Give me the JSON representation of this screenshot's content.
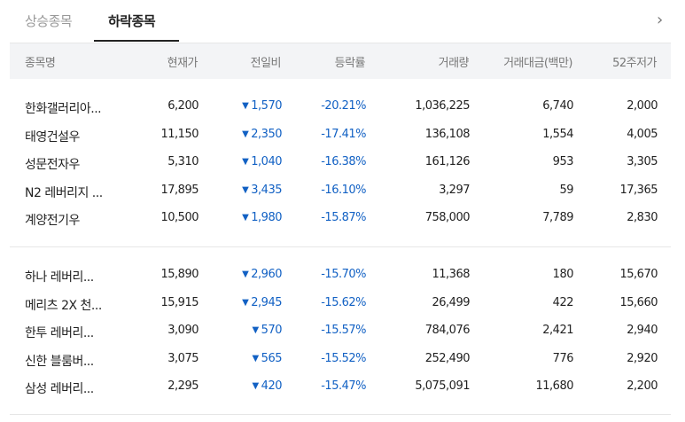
{
  "tabs": [
    {
      "label": "상승종목",
      "active": false
    },
    {
      "label": "하락종목",
      "active": true
    }
  ],
  "columns": [
    "종목명",
    "현재가",
    "전일비",
    "등락률",
    "거래량",
    "거래대금(백만)",
    "52주저가"
  ],
  "groups": [
    [
      {
        "name": "한화갤러리아...",
        "price": "6,200",
        "change": "1,570",
        "rate": "-20.21%",
        "volume": "1,036,225",
        "amount": "6,740",
        "low52": "2,000"
      },
      {
        "name": "태영건설우",
        "price": "11,150",
        "change": "2,350",
        "rate": "-17.41%",
        "volume": "136,108",
        "amount": "1,554",
        "low52": "4,005"
      },
      {
        "name": "성문전자우",
        "price": "5,310",
        "change": "1,040",
        "rate": "-16.38%",
        "volume": "161,126",
        "amount": "953",
        "low52": "3,305"
      },
      {
        "name": "N2 레버리지 ...",
        "price": "17,895",
        "change": "3,435",
        "rate": "-16.10%",
        "volume": "3,297",
        "amount": "59",
        "low52": "17,365"
      },
      {
        "name": "계양전기우",
        "price": "10,500",
        "change": "1,980",
        "rate": "-15.87%",
        "volume": "758,000",
        "amount": "7,789",
        "low52": "2,830"
      }
    ],
    [
      {
        "name": "하나 레버리...",
        "price": "15,890",
        "change": "2,960",
        "rate": "-15.70%",
        "volume": "11,368",
        "amount": "180",
        "low52": "15,670"
      },
      {
        "name": "메리츠 2X 천...",
        "price": "15,915",
        "change": "2,945",
        "rate": "-15.62%",
        "volume": "26,499",
        "amount": "422",
        "low52": "15,660"
      },
      {
        "name": "한투 레버리...",
        "price": "3,090",
        "change": "570",
        "rate": "-15.57%",
        "volume": "784,076",
        "amount": "2,421",
        "low52": "2,940"
      },
      {
        "name": "신한 블룸버...",
        "price": "3,075",
        "change": "565",
        "rate": "-15.52%",
        "volume": "252,490",
        "amount": "776",
        "low52": "2,920"
      },
      {
        "name": "삼성 레버리...",
        "price": "2,295",
        "change": "420",
        "rate": "-15.47%",
        "volume": "5,075,091",
        "amount": "11,680",
        "low52": "2,200"
      }
    ]
  ],
  "icons": {
    "next": "chevron-right-icon",
    "down": "triangle-down-icon"
  },
  "colors": {
    "down": "#1261c4",
    "header_bg": "#f3f4f6"
  }
}
